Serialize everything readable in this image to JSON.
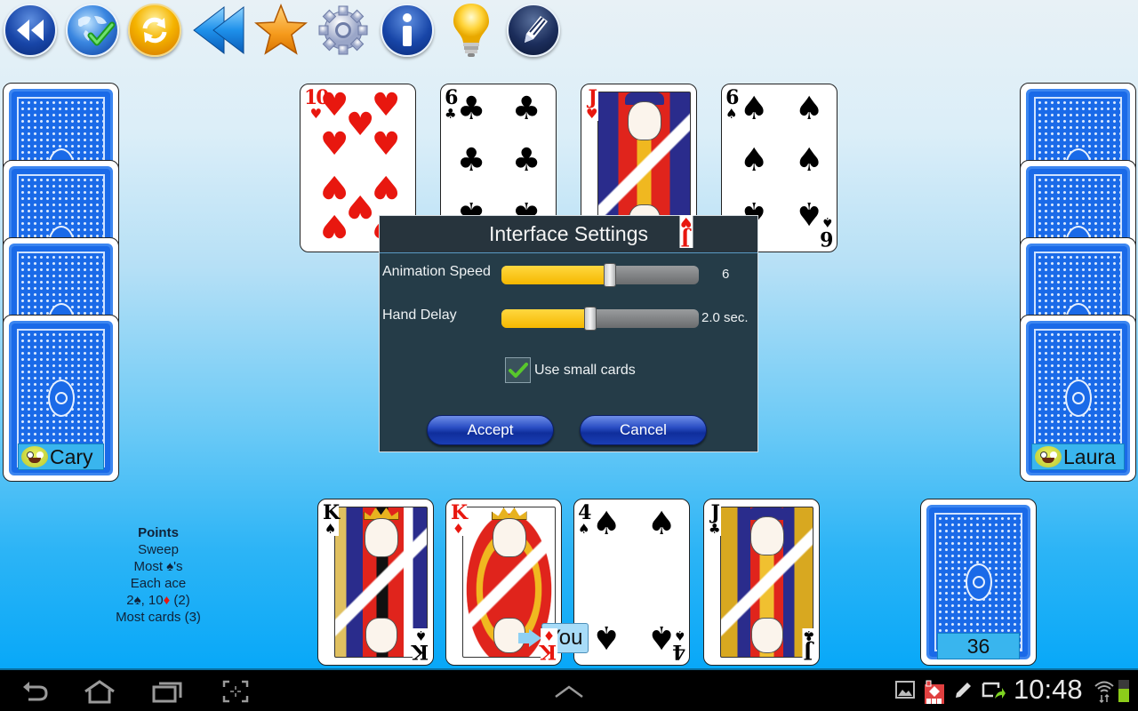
{
  "toolbar": {
    "buttons": [
      {
        "name": "rewind-button",
        "icon": "double-chevron-left-icon"
      },
      {
        "name": "online-button",
        "icon": "globe-check-icon"
      },
      {
        "name": "restart-button",
        "icon": "refresh-icon"
      },
      {
        "name": "undo-button",
        "icon": "double-arrow-left-icon"
      },
      {
        "name": "favorite-button",
        "icon": "star-icon"
      },
      {
        "name": "settings-button",
        "icon": "gear-icon"
      },
      {
        "name": "info-button",
        "icon": "info-icon"
      },
      {
        "name": "hint-button",
        "icon": "lightbulb-icon"
      },
      {
        "name": "notes-button",
        "icon": "pencil-icon"
      }
    ]
  },
  "players": {
    "left": {
      "name": "Cary",
      "cards_in_hand": 4
    },
    "right": {
      "name": "Laura",
      "cards_in_hand": 4
    },
    "you": {
      "label": "You"
    }
  },
  "table_cards": [
    {
      "rank": "10",
      "suit": "♥",
      "color": "red"
    },
    {
      "rank": "6",
      "suit": "♣",
      "color": "black"
    },
    {
      "rank": "J",
      "suit": "♥",
      "color": "red"
    },
    {
      "rank": "6",
      "suit": "♠",
      "color": "black"
    }
  ],
  "hand_cards": [
    {
      "rank": "K",
      "suit": "♠",
      "color": "black"
    },
    {
      "rank": "K",
      "suit": "♦",
      "color": "red"
    },
    {
      "rank": "4",
      "suit": "♠",
      "color": "black"
    },
    {
      "rank": "J",
      "suit": "♣",
      "color": "black"
    }
  ],
  "deck": {
    "remaining": "36"
  },
  "points": {
    "title": "Points",
    "lines": [
      "Sweep",
      "Most ♠'s",
      "Each ace"
    ],
    "special_line": {
      "prefix": "2",
      "spade": "♠",
      "middle": ", 10",
      "diamond": "♦",
      "suffix": " (2)"
    },
    "last_line": "Most cards (3)"
  },
  "dialog": {
    "title": "Interface Settings",
    "animation_speed": {
      "label": "Animation Speed",
      "value": "6",
      "fraction": 0.55
    },
    "hand_delay": {
      "label": "Hand Delay",
      "value": "2.0 sec.",
      "fraction": 0.45
    },
    "small_cards": {
      "label": "Use small cards",
      "checked": true
    },
    "accept_label": "Accept",
    "cancel_label": "Cancel"
  },
  "system_bar": {
    "time": "10:48",
    "nav": [
      "back-icon",
      "home-icon",
      "recent-apps-icon",
      "screenshot-icon"
    ],
    "status_icons": [
      "gallery-icon",
      "app-notification-icon",
      "edit-icon",
      "screen-share-icon",
      "wifi-icon",
      "battery-icon"
    ]
  },
  "colors": {
    "slider_fill": "#f5b800",
    "dialog_bg": "#253c48",
    "button_blue": "#1a3eb4",
    "card_back": "#1a6ae8",
    "label_bg": "#39b5ee",
    "heart_red": "#e8170f"
  }
}
